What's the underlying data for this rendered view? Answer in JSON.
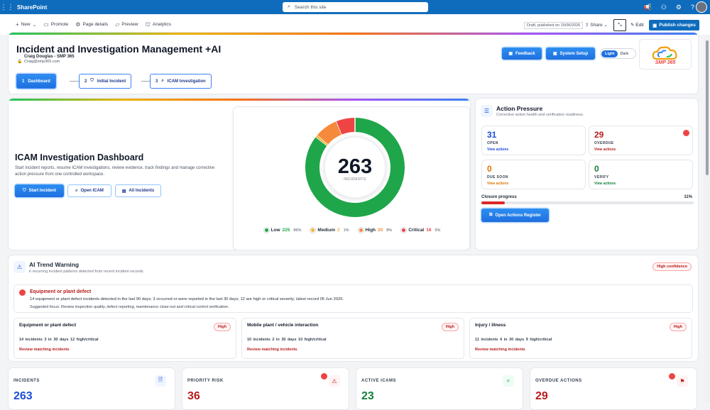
{
  "suite": {
    "brand": "SharePoint",
    "search_placeholder": "Search this site"
  },
  "commandbar": {
    "new": "New",
    "promote": "Promote",
    "page_details": "Page details",
    "preview": "Preview",
    "analytics": "Analytics",
    "draft": "Draft, published on 15/06/2026",
    "share": "Share",
    "edit": "Edit",
    "publish": "Publish changes"
  },
  "header": {
    "title": "Incident and Investigation Management +AI",
    "user": "Craig Douglas - SMP 365",
    "email": "Craig@smp365.com",
    "feedback": "Feedback",
    "system_setup": "System Setup",
    "light": "Light",
    "dark": "Dark",
    "logo_text": "SMP 365",
    "steps": [
      {
        "num": "1",
        "label": "Dashboard"
      },
      {
        "num": "2",
        "label": "Initial Incident"
      },
      {
        "num": "3",
        "label": "ICAM Investigation"
      }
    ]
  },
  "dashboard": {
    "title": "ICAM Investigation Dashboard",
    "description": "Start incident reports, resume ICAM investigations, review evidence, track findings and manage corrective action pressure from one controlled workspace.",
    "start": "Start Incident",
    "open_icam": "Open ICAM",
    "all": "All Incidents"
  },
  "chart_data": {
    "type": "pie",
    "title": "",
    "center_value": "263",
    "center_label": "INCIDENTS",
    "categories": [
      "Low",
      "Medium",
      "High",
      "Critical"
    ],
    "values": [
      225,
      2,
      20,
      16
    ],
    "percents": [
      "86%",
      "1%",
      "8%",
      "6%"
    ],
    "colors": [
      "#1fa64a",
      "#f5b233",
      "#f58a3c",
      "#ef4444"
    ]
  },
  "action": {
    "title": "Action Pressure",
    "subtitle": "Corrective action health and verification readiness.",
    "tiles": [
      {
        "num": "31",
        "label": "OPEN",
        "link": "View actions",
        "color": "#1d4ed8"
      },
      {
        "num": "29",
        "label": "OVERDUE",
        "link": "View actions",
        "color": "#b91c1c"
      },
      {
        "num": "0",
        "label": "DUE SOON",
        "link": "View actions",
        "color": "#d97706"
      },
      {
        "num": "0",
        "label": "VERIFY",
        "link": "View actions",
        "color": "#15803d"
      }
    ],
    "progress_label": "Closure progress",
    "progress_value": "11%",
    "progress": 0.11,
    "register": "Open Actions Register"
  },
  "trend": {
    "title": "AI Trend Warning",
    "subtitle": "6 recurring incident patterns detected from recent incident records.",
    "confidence": "High confidence",
    "alert_title": "Equipment or plant defect",
    "alert_text": "14 equipment or plant defect incidents detected in the last 90 days; 3 occurred or were reported in the last 30 days; 12 are high or critical severity; latest record 05 Jun 2026.",
    "alert_focus": "Suggested focus: Review inspection quality, defect reporting, maintenance close-out and critical control verification.",
    "items": [
      {
        "title": "Equipment or plant defect",
        "badge": "High",
        "stats": "14 incidents   3 in 30 days   12 high/critical",
        "link": "Review matching incidents"
      },
      {
        "title": "Mobile plant / vehicle interaction",
        "badge": "High",
        "stats": "10 incidents   2 in 30 days   10 high/critical",
        "link": "Review matching incidents"
      },
      {
        "title": "Injury / illness",
        "badge": "High",
        "stats": "11 incidents   4 in 30 days   9 high/critical",
        "link": "Review matching incidents"
      }
    ]
  },
  "kpis": [
    {
      "label": "INCIDENTS",
      "value": "263",
      "color": "#1d4ed8",
      "icon": "document-icon"
    },
    {
      "label": "PRIORITY RISK",
      "value": "36",
      "color": "#b91c1c",
      "icon": "warning-icon"
    },
    {
      "label": "ACTIVE ICAMS",
      "value": "23",
      "color": "#15803d",
      "icon": "search-icon"
    },
    {
      "label": "OVERDUE ACTIONS",
      "value": "29",
      "color": "#b91c1c",
      "icon": "flag-icon"
    }
  ]
}
